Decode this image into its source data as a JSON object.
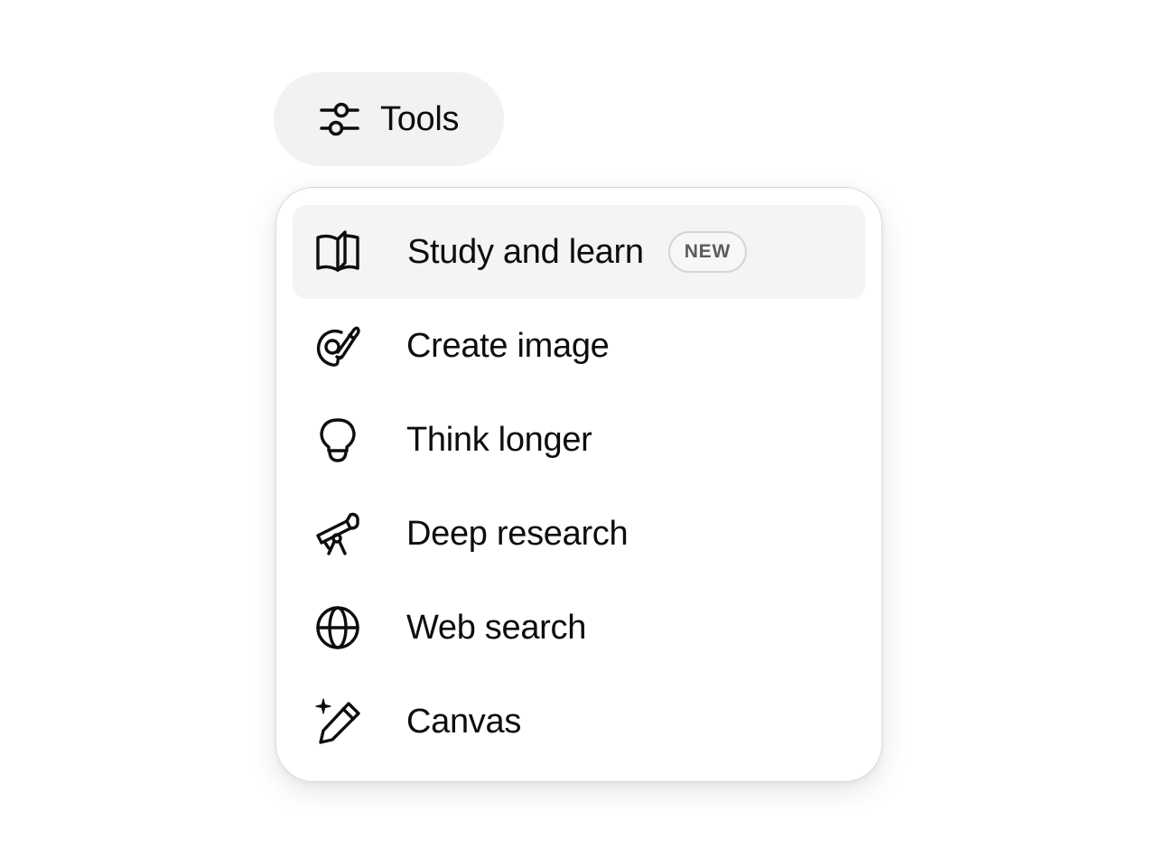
{
  "tools_button": {
    "label": "Tools",
    "icon": "sliders-icon"
  },
  "menu": {
    "items": [
      {
        "label": "Study and learn",
        "icon": "open-book-icon",
        "badge": "NEW",
        "highlighted": true
      },
      {
        "label": "Create image",
        "icon": "palette-brush-icon"
      },
      {
        "label": "Think longer",
        "icon": "lightbulb-icon"
      },
      {
        "label": "Deep research",
        "icon": "telescope-icon"
      },
      {
        "label": "Web search",
        "icon": "globe-icon"
      },
      {
        "label": "Canvas",
        "icon": "pencil-sparkle-icon"
      }
    ]
  },
  "colors": {
    "text": "#0d0d0d",
    "button_bg": "#f2f2f2",
    "highlight_bg": "#f4f4f4",
    "menu_border": "#d9d9d9",
    "badge_text": "#5c5c5c"
  }
}
